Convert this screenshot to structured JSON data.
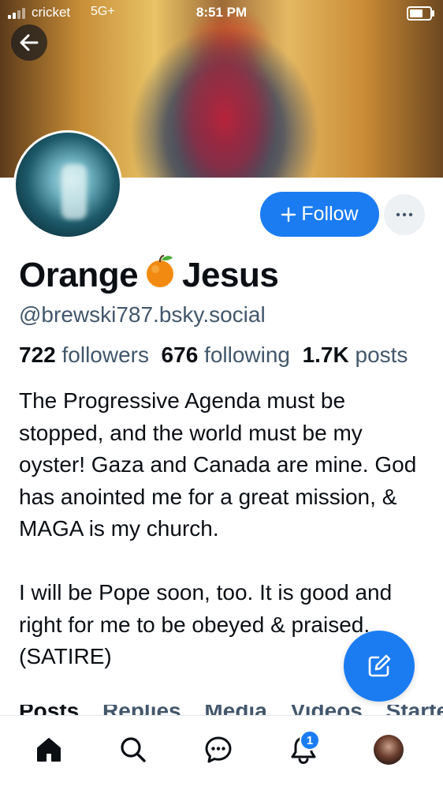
{
  "status_bar": {
    "carrier": "cricket",
    "network": "5G+",
    "time": "8:51 PM"
  },
  "profile": {
    "display_name_first": "Orange",
    "display_name_emoji": "🍊",
    "display_name_last": "Jesus",
    "handle": "@brewski787.bsky.social",
    "follow_label": "Follow",
    "stats": {
      "followers_count": "722",
      "followers_label": "followers",
      "following_count": "676",
      "following_label": "following",
      "posts_count": "1.7K",
      "posts_label": "posts"
    },
    "bio_paragraph_1": "The Progressive Agenda must be stopped, and the world must be my oyster! Gaza and Canada are mine. God has anointed me for a great mission, & MAGA is my church.",
    "bio_paragraph_2": "I will be Pope soon, too. It is good and right for me to be obeyed & praised. (SATIRE)"
  },
  "tabs": [
    "Posts",
    "Replies",
    "Media",
    "Videos",
    "Starter Packs"
  ],
  "bottom_nav": {
    "items": [
      "home-icon",
      "search-icon",
      "chat-icon",
      "bell-icon",
      "profile-avatar"
    ],
    "notifications_badge": "1"
  },
  "colors": {
    "accent": "#1b7cf2",
    "secondary_text": "#42576c",
    "primary_text": "#0b0f14"
  }
}
